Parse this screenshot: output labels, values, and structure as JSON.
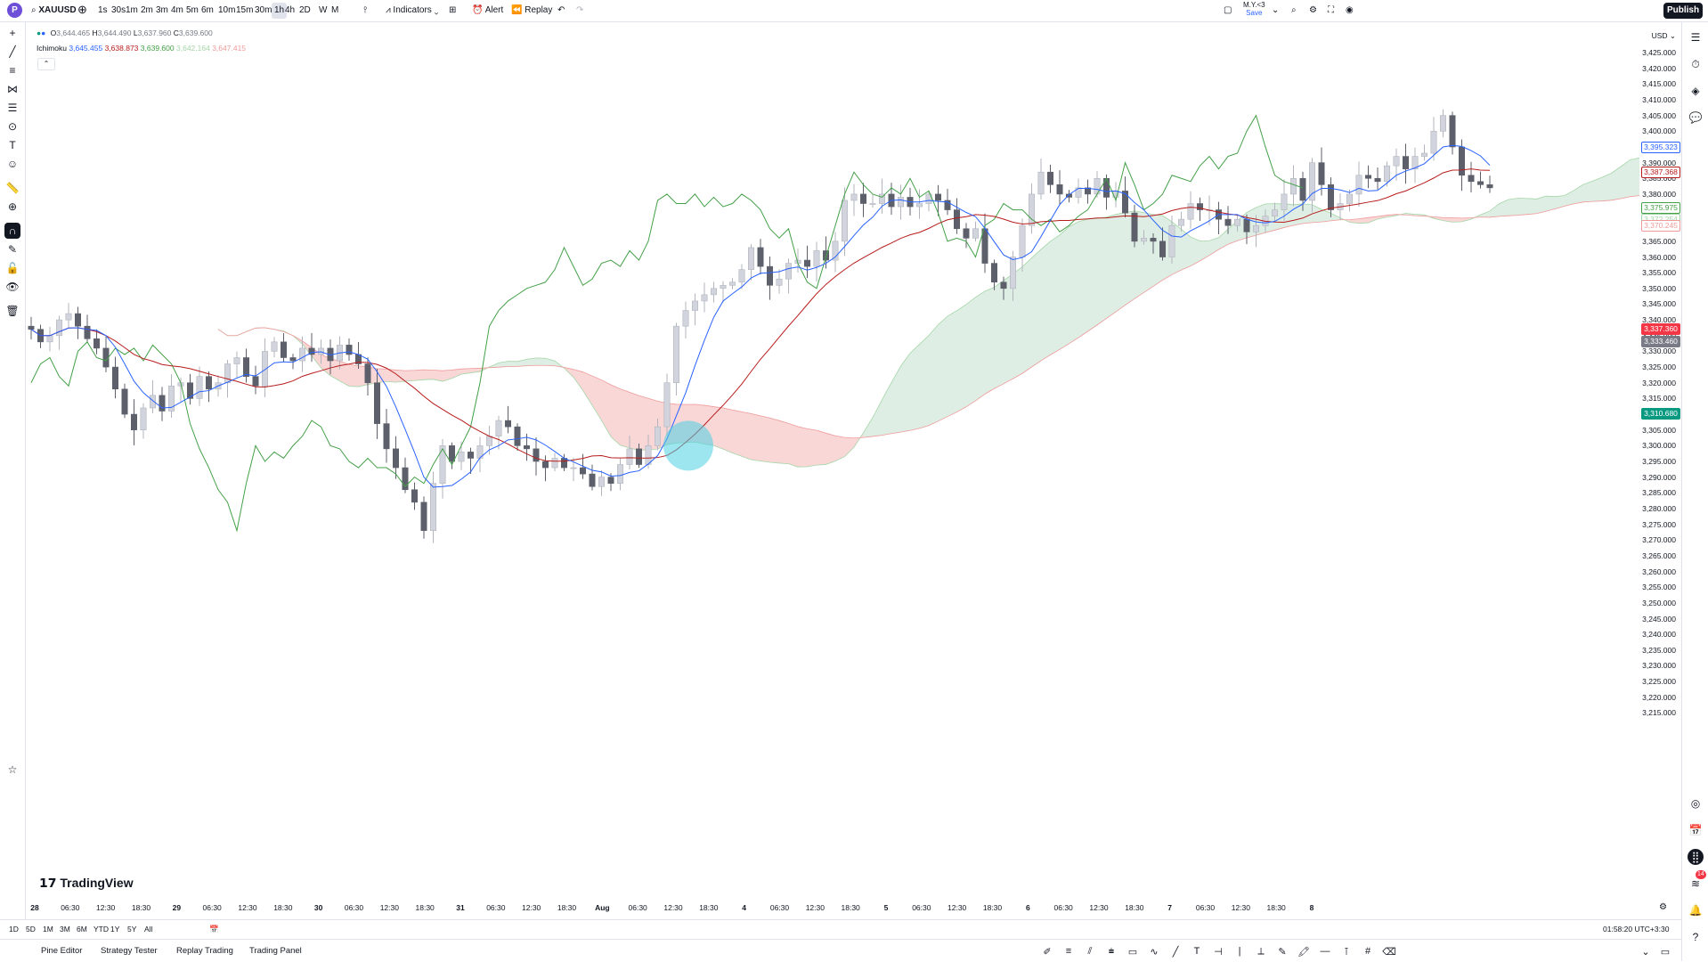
{
  "topbar": {
    "logo_letter": "P",
    "symbol": "XAUUSD",
    "timeframes": [
      "1s",
      "30s",
      "1m",
      "2m",
      "3m",
      "4m",
      "5m",
      "6m",
      "10m",
      "15m",
      "30m",
      "1h",
      "4h",
      "2D",
      "W",
      "M"
    ],
    "active_timeframe": "1h",
    "indicators_label": "Indicators",
    "alert_label": "Alert",
    "replay_label": "Replay",
    "layout_name": "M.Y.<3",
    "layout_sub": "Save",
    "publish_label": "Publish"
  },
  "legend": {
    "ohlc_o_label": "O",
    "ohlc_o": "3,644.465",
    "ohlc_h_label": "H",
    "ohlc_h": "3,644.490",
    "ohlc_l_label": "L",
    "ohlc_l": "3,637.960",
    "ohlc_c_label": "C",
    "ohlc_c": "3,639.600",
    "indicator_name": "Ichimoku",
    "ind_values": [
      "3,645.455",
      "3,638.873",
      "3,639.600",
      "3,642.164",
      "3,647.415"
    ],
    "ind_colors": [
      "#2962ff",
      "#b71c1c",
      "#43a047",
      "#a5d6a7",
      "#ef9a9a"
    ]
  },
  "price_axis": {
    "currency": "USD",
    "ticks": [
      "3,425.000",
      "3,420.000",
      "3,415.000",
      "3,410.000",
      "3,405.000",
      "3,400.000",
      "3,395.000",
      "3,390.000",
      "3,385.000",
      "3,380.000",
      "3,375.000",
      "3,370.000",
      "3,365.000",
      "3,360.000",
      "3,355.000",
      "3,350.000",
      "3,345.000",
      "3,340.000",
      "3,335.000",
      "3,330.000",
      "3,325.000",
      "3,320.000",
      "3,315.000",
      "3,310.000",
      "3,305.000",
      "3,300.000",
      "3,295.000",
      "3,290.000",
      "3,285.000",
      "3,280.000",
      "3,275.000",
      "3,270.000",
      "3,265.000",
      "3,260.000",
      "3,255.000",
      "3,250.000",
      "3,245.000",
      "3,240.000",
      "3,235.000",
      "3,230.000",
      "3,225.000",
      "3,220.000",
      "3,215.000"
    ],
    "labels": [
      {
        "text": "3,395.323",
        "bg": "#ffffff",
        "fg": "#2962ff",
        "value": 3395.323
      },
      {
        "text": "3,387.368",
        "bg": "#ffffff",
        "fg": "#b71c1c",
        "value": 3387.368
      },
      {
        "text": "3,375.975",
        "bg": "#ffffff",
        "fg": "#43a047",
        "value": 3375.975
      },
      {
        "text": "3,372.254",
        "bg": "#ffffff",
        "fg": "#a5d6a7",
        "value": 3372.254
      },
      {
        "text": "3,370.245",
        "bg": "#ffffff",
        "fg": "#ef9a9a",
        "value": 3370.245
      },
      {
        "text": "3,337.360",
        "bg": "#f23645",
        "fg": "#ffffff",
        "value": 3337.36
      },
      {
        "text": "3,333.460",
        "bg": "#787b86",
        "fg": "#ffffff",
        "value": 3333.46
      },
      {
        "text": "3,310.680",
        "bg": "#089981",
        "fg": "#ffffff",
        "value": 3310.68
      }
    ]
  },
  "time_axis": {
    "ticks": [
      "28",
      "06:30",
      "12:30",
      "18:30",
      "29",
      "06:30",
      "12:30",
      "18:30",
      "30",
      "06:30",
      "12:30",
      "18:30",
      "31",
      "06:30",
      "12:30",
      "18:30",
      "Aug",
      "06:30",
      "12:30",
      "18:30",
      "4",
      "06:30",
      "12:30",
      "18:30",
      "5",
      "06:30",
      "12:30",
      "18:30",
      "6",
      "06:30",
      "12:30",
      "18:30",
      "7",
      "06:30",
      "12:30",
      "18:30",
      "8"
    ]
  },
  "range_bar": {
    "ranges": [
      "1D",
      "5D",
      "1M",
      "3M",
      "6M",
      "YTD",
      "1Y",
      "5Y",
      "All"
    ],
    "clock": "01:58:20 UTC+3:30"
  },
  "bottom_tabs": [
    "Pine Editor",
    "Strategy Tester",
    "Replay Trading",
    "Trading Panel"
  ],
  "watermark": "TradingView",
  "badge_count": "14",
  "colors": {
    "candle_up": "#d1d4dc",
    "candle_down": "#5d606b",
    "tenkan": "#2962ff",
    "kijun": "#b71c1c",
    "lagging": "#43a047",
    "cloud_bear": "#f8d0d0",
    "cloud_bull": "#d8ebdf",
    "highlight": "#4dd0e1"
  },
  "chart_data": {
    "type": "candlestick",
    "symbol": "XAUUSD",
    "timeframe": "1h",
    "ylim": [
      3212,
      3427
    ],
    "close_path": [
      3337,
      3333,
      3335,
      3340,
      3342,
      3338,
      3334,
      3331,
      3325,
      3318,
      3310,
      3305,
      3312,
      3316,
      3311,
      3319,
      3320,
      3315,
      3322,
      3318,
      3320,
      3326,
      3328,
      3322,
      3319,
      3330,
      3333,
      3328,
      3327,
      3331,
      3329,
      3331,
      3327,
      3332,
      3329,
      3326,
      3320,
      3307,
      3299,
      3293,
      3286,
      3282,
      3273,
      3288,
      3300,
      3295,
      3298,
      3296,
      3300,
      3303,
      3308,
      3306,
      3300,
      3299,
      3295,
      3293,
      3296,
      3293,
      3293,
      3291,
      3287,
      3290,
      3288,
      3294,
      3299,
      3294,
      3300,
      3306,
      3320,
      3338,
      3343,
      3346,
      3348,
      3350,
      3351,
      3352,
      3356,
      3363,
      3357,
      3351,
      3353,
      3358,
      3359,
      3357,
      3362,
      3359,
      3365,
      3378,
      3380,
      3377,
      3377,
      3380,
      3376,
      3379,
      3376,
      3377,
      3380,
      3378,
      3375,
      3369,
      3366,
      3369,
      3358,
      3352,
      3350,
      3360,
      3370,
      3380,
      3387,
      3383,
      3380,
      3379,
      3382,
      3380,
      3385,
      3379,
      3381,
      3374,
      3365,
      3366,
      3365,
      3360,
      3370,
      3372,
      3377,
      3375,
      3375,
      3372,
      3370,
      3372,
      3368,
      3370,
      3373,
      3375,
      3380,
      3385,
      3378,
      3390,
      3383,
      3375,
      3377,
      3380,
      3386,
      3385,
      3384,
      3389,
      3392,
      3388,
      3392,
      3393,
      3400,
      3405,
      3395,
      3386,
      3384,
      3383,
      3382
    ]
  }
}
